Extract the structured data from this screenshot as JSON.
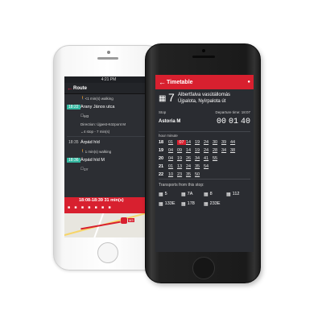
{
  "white_phone": {
    "status_time": "4:21 PM",
    "header": {
      "title": "Route"
    },
    "rows": [
      {
        "time": "",
        "text": "<1 min(s) walking",
        "kind": "small"
      },
      {
        "time": "18:22",
        "text": "Arany János utca",
        "kind": "main",
        "highlight": true
      },
      {
        "time": "",
        "text": "M3",
        "kind": "small"
      },
      {
        "time": "",
        "text": "Direction: Újpest-Központ M",
        "kind": "small"
      },
      {
        "time": "",
        "text": "4 stop - 7 min(s)",
        "kind": "stops"
      },
      {
        "time": "18:35",
        "text": "Árpád híd",
        "kind": "main",
        "highlight": false
      },
      {
        "time": "",
        "text": "1 min(s) walking",
        "kind": "small"
      },
      {
        "time": "18:36",
        "text": "Árpád híd M",
        "kind": "main",
        "highlight": true
      },
      {
        "time": "",
        "text": "1Y",
        "kind": "small"
      }
    ],
    "summary": "18:08-18:39 31 min(s)",
    "map_label": "M3"
  },
  "black_phone": {
    "header": {
      "title": "Timetable"
    },
    "line": {
      "number": "7",
      "destination_line1": "Albertfalva vasútállomás",
      "destination_line2": "Újpalota, Nyírpalota út"
    },
    "meta": {
      "stop_label": "Stop",
      "departure": "Departure time: 18:07"
    },
    "stop_name": "Astoria M",
    "countdown": [
      "00",
      "01",
      "40"
    ],
    "timetable_header": "hour  minute",
    "timetable": [
      {
        "hour": "18",
        "minutes": [
          "01",
          "07",
          "14",
          "19",
          "24",
          "30",
          "39",
          "44"
        ],
        "highlight_index": 1
      },
      {
        "hour": "19",
        "minutes": [
          "04",
          "09",
          "14",
          "19",
          "24",
          "28",
          "34",
          "38"
        ],
        "highlight_index": -1
      },
      {
        "hour": "20",
        "minutes": [
          "04",
          "19",
          "26",
          "34",
          "41",
          "55"
        ],
        "highlight_index": -1
      },
      {
        "hour": "21",
        "minutes": [
          "01",
          "13",
          "24",
          "35",
          "54"
        ],
        "highlight_index": -1
      },
      {
        "hour": "22",
        "minutes": [
          "10",
          "23",
          "35",
          "50"
        ],
        "highlight_index": -1
      }
    ],
    "transports_title": "Transports from this stop:",
    "transports": [
      "5",
      "7A",
      "8",
      "112",
      "133E",
      "178",
      "233E"
    ]
  }
}
